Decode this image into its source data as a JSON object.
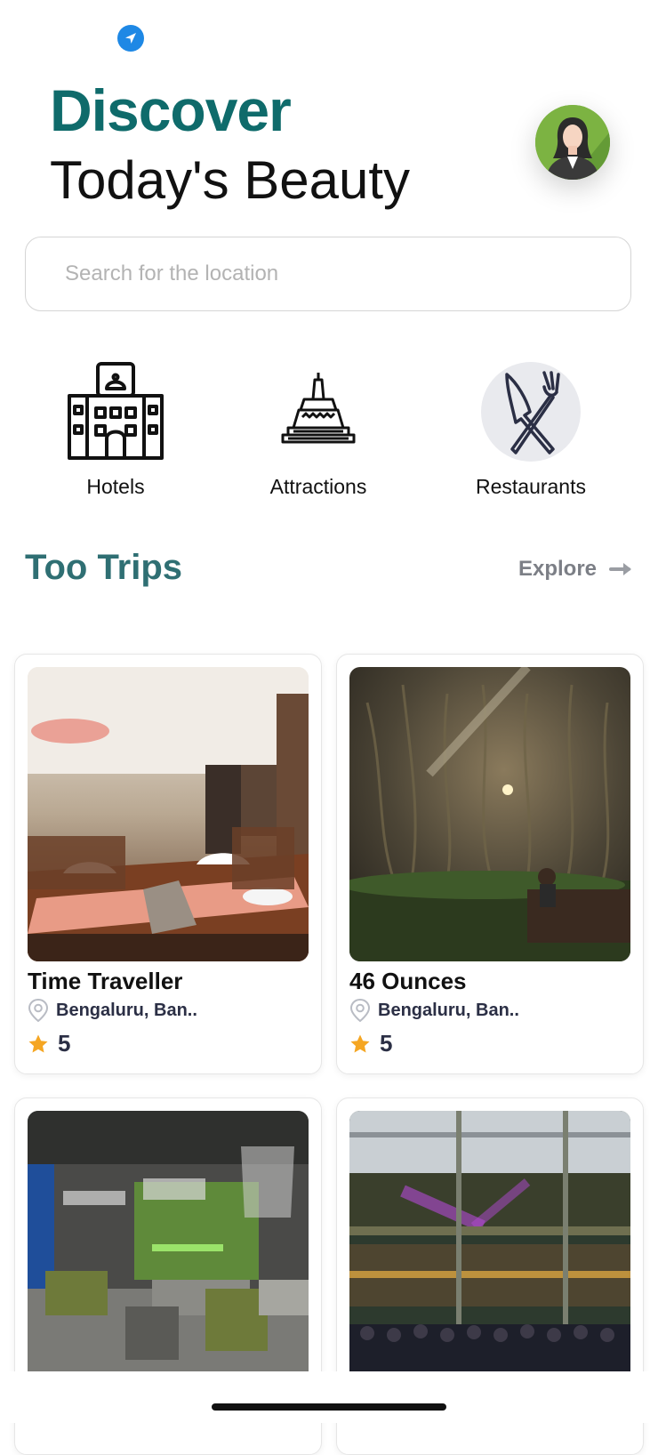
{
  "header": {
    "title": "Discover",
    "subtitle": "Today's Beauty"
  },
  "search": {
    "placeholder": "Search for the location",
    "value": ""
  },
  "categories": [
    {
      "label": "Hotels",
      "icon": "hotel-icon"
    },
    {
      "label": "Attractions",
      "icon": "stupa-icon"
    },
    {
      "label": "Restaurants",
      "icon": "fork-knife-icon",
      "selected": true
    }
  ],
  "section": {
    "title": "Too Trips",
    "explore_label": "Explore"
  },
  "trips": [
    {
      "name": "Time Traveller",
      "location": "Bengaluru, Ban..",
      "rating": "5"
    },
    {
      "name": "46 Ounces",
      "location": "Bengaluru, Ban..",
      "rating": "5"
    },
    {
      "name": "",
      "location": "",
      "rating": ""
    },
    {
      "name": "",
      "location": "",
      "rating": ""
    }
  ],
  "colors": {
    "accent": "#0f6b6b",
    "section_title": "#2f6f73",
    "star": "#f5a623",
    "location_icon": "#1e88e5"
  }
}
